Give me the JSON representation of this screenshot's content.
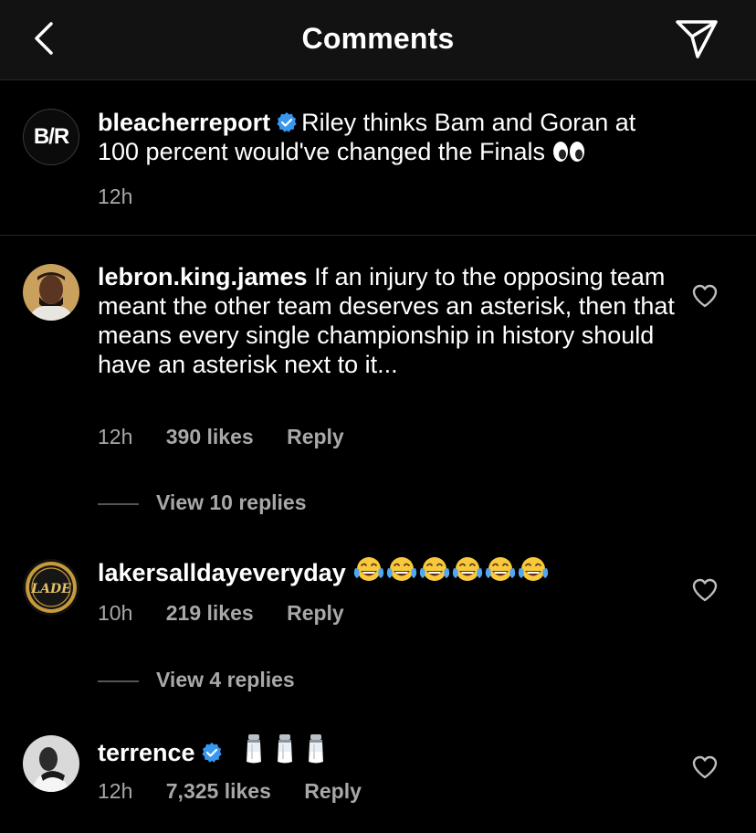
{
  "header": {
    "title": "Comments",
    "back_icon": "chevron-left-icon",
    "send_icon": "paper-plane-icon"
  },
  "caption": {
    "username": "bleacherreport",
    "avatar_text": "B/R",
    "verified": true,
    "text": "Riley thinks Bam and Goran at 100 percent would've changed the Finals",
    "emoji": "eyes",
    "time": "12h"
  },
  "comments": [
    {
      "username": "lebron.king.james",
      "text": "If an injury to the opposing team meant the other team deserves an asterisk, then that means every single championship in history should have an asterisk next to it...",
      "time": "12h",
      "likes": "390 likes",
      "reply": "Reply",
      "view_replies": "View 10 replies"
    },
    {
      "username": "lakersalldayeveryday",
      "text": "",
      "emoji": "face-with-tears-of-joy x6",
      "avatar_text": "LADE",
      "time": "10h",
      "likes": "219 likes",
      "reply": "Reply",
      "view_replies": "View 4 replies"
    },
    {
      "username": "terrence",
      "verified": true,
      "text": "",
      "emoji": "salt-shaker x3",
      "time": "12h",
      "likes": "7,325 likes",
      "reply": "Reply"
    }
  ],
  "colors": {
    "background": "#000000",
    "header": "#121212",
    "secondary_text": "#a8a8a8",
    "verified_blue": "#3897f0"
  }
}
